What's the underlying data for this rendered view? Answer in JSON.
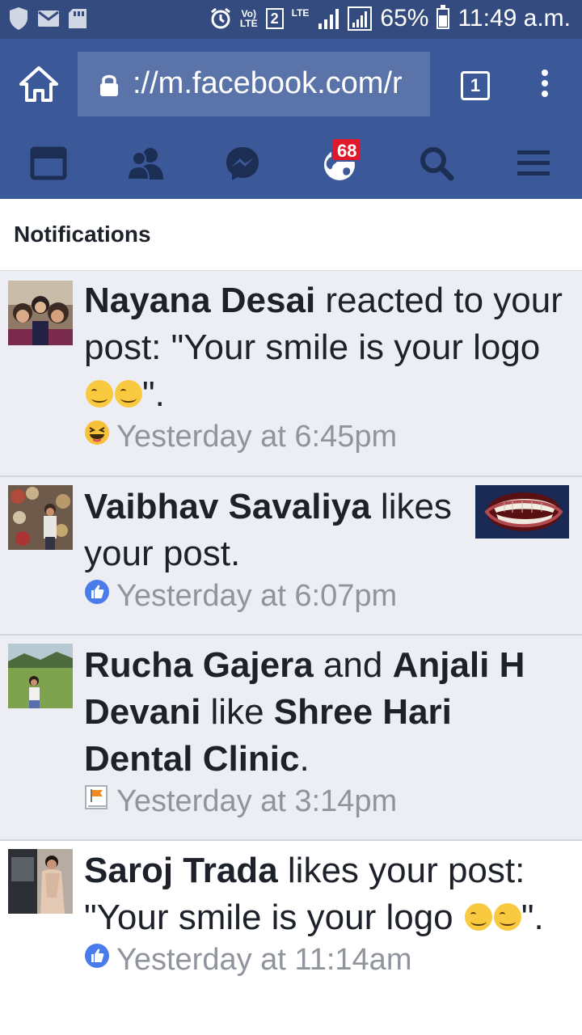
{
  "status_bar": {
    "volte": "Vo)",
    "lte_small": "LTE",
    "sim": "2",
    "lte": "LTE",
    "battery": "65%",
    "time": "11:49 a.m."
  },
  "browser": {
    "url": "://m.facebook.com/r",
    "tab_count": "1"
  },
  "nav": {
    "notification_count": "68",
    "items": [
      "news-feed",
      "friend-requests",
      "messages",
      "notifications",
      "search",
      "menu"
    ]
  },
  "header": {
    "title": "Notifications"
  },
  "notifications": [
    {
      "actor": "Nayana Desai",
      "text_a": " reacted to your post: \"Your smile is your logo ",
      "text_b": "\".",
      "time": "Yesterday at 6:45pm",
      "icon": "laughing-reaction-icon",
      "unread": true
    },
    {
      "actor": "Vaibhav Savaliya",
      "text_a": " likes your post.",
      "time": "Yesterday at 6:07pm",
      "icon": "like-icon",
      "unread": true,
      "thumbnail": "teeth-photo"
    },
    {
      "actor": "Rucha Gajera",
      "joiner": " and ",
      "actor2": "Anjali H Devani",
      "text_a": " like ",
      "target": "Shree Hari Dental Clinic",
      "text_b": ".",
      "time": "Yesterday at 3:14pm",
      "icon": "page-flag-icon",
      "unread": true
    },
    {
      "actor": "Saroj Trada",
      "text_a": " likes your post: \"Your smile is your logo ",
      "text_b": "\".",
      "time": "Yesterday at 11:14am",
      "icon": "like-icon",
      "unread": false
    }
  ],
  "colors": {
    "status_bar": "#344b80",
    "fb_blue": "#3b5998",
    "url_box": "#5a74aa",
    "badge": "#e0182b",
    "unread_bg": "#eceef4",
    "timestamp": "#90949c"
  }
}
